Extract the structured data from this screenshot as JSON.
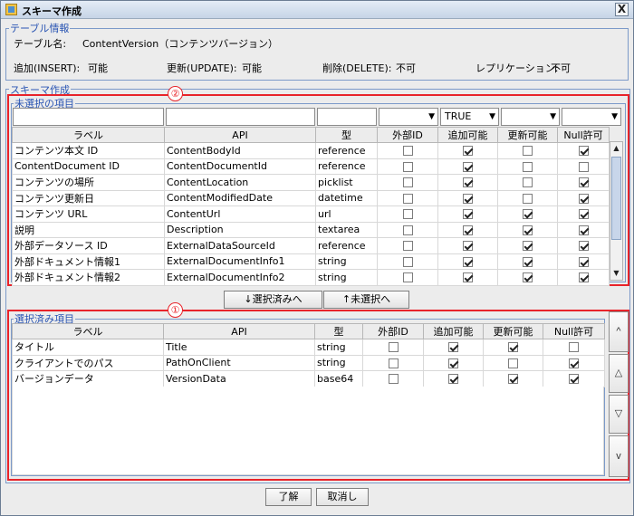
{
  "window": {
    "title": "スキーマ作成",
    "close_glyph": "X"
  },
  "table_info": {
    "legend": "テーブル情報",
    "name_label": "テーブル名:",
    "name_value": "ContentVersion（コンテンツバージョン）",
    "insert_label": "追加(INSERT):",
    "insert_value": "可能",
    "update_label": "更新(UPDATE):",
    "update_value": "可能",
    "delete_label": "削除(DELETE):",
    "delete_value": "不可",
    "replication_label": "レプリケーション:",
    "replication_value": "不可"
  },
  "schema": {
    "legend": "スキーマ作成",
    "marker_unselected": "②",
    "marker_selected": "①"
  },
  "unselected": {
    "legend": "未選択の項目",
    "filter_addable": "TRUE",
    "columns": [
      "ラベル",
      "API",
      "型",
      "外部ID",
      "追加可能",
      "更新可能",
      "Null許可"
    ],
    "rows": [
      {
        "label": "コンテンツ本文 ID",
        "api": "ContentBodyId",
        "type": "reference",
        "ext": false,
        "add": true,
        "upd": false,
        "nul": true
      },
      {
        "label": "ContentDocument ID",
        "api": "ContentDocumentId",
        "type": "reference",
        "ext": false,
        "add": true,
        "upd": false,
        "nul": false
      },
      {
        "label": "コンテンツの場所",
        "api": "ContentLocation",
        "type": "picklist",
        "ext": false,
        "add": true,
        "upd": false,
        "nul": true
      },
      {
        "label": "コンテンツ更新日",
        "api": "ContentModifiedDate",
        "type": "datetime",
        "ext": false,
        "add": true,
        "upd": false,
        "nul": true
      },
      {
        "label": "コンテンツ URL",
        "api": "ContentUrl",
        "type": "url",
        "ext": false,
        "add": true,
        "upd": true,
        "nul": true
      },
      {
        "label": "説明",
        "api": "Description",
        "type": "textarea",
        "ext": false,
        "add": true,
        "upd": true,
        "nul": true
      },
      {
        "label": "外部データソース ID",
        "api": "ExternalDataSourceId",
        "type": "reference",
        "ext": false,
        "add": true,
        "upd": true,
        "nul": true
      },
      {
        "label": "外部ドキュメント情報1",
        "api": "ExternalDocumentInfo1",
        "type": "string",
        "ext": false,
        "add": true,
        "upd": true,
        "nul": true
      },
      {
        "label": "外部ドキュメント情報2",
        "api": "ExternalDocumentInfo2",
        "type": "string",
        "ext": false,
        "add": true,
        "upd": true,
        "nul": true
      }
    ]
  },
  "move_buttons": {
    "to_selected": "↓選択済みへ",
    "to_unselected": "↑未選択へ"
  },
  "selected": {
    "legend": "選択済み項目",
    "columns": [
      "ラベル",
      "API",
      "型",
      "外部ID",
      "追加可能",
      "更新可能",
      "Null許可"
    ],
    "rows": [
      {
        "label": "タイトル",
        "api": "Title",
        "type": "string",
        "ext": false,
        "add": true,
        "upd": true,
        "nul": false
      },
      {
        "label": "クライアントでのパス",
        "api": "PathOnClient",
        "type": "string",
        "ext": false,
        "add": true,
        "upd": false,
        "nul": true
      },
      {
        "label": "バージョンデータ",
        "api": "VersionData",
        "type": "base64",
        "ext": false,
        "add": true,
        "upd": true,
        "nul": true
      }
    ],
    "side_buttons": [
      "^",
      "△",
      "▽",
      "v"
    ]
  },
  "footer": {
    "ok": "了解",
    "cancel": "取消し"
  }
}
